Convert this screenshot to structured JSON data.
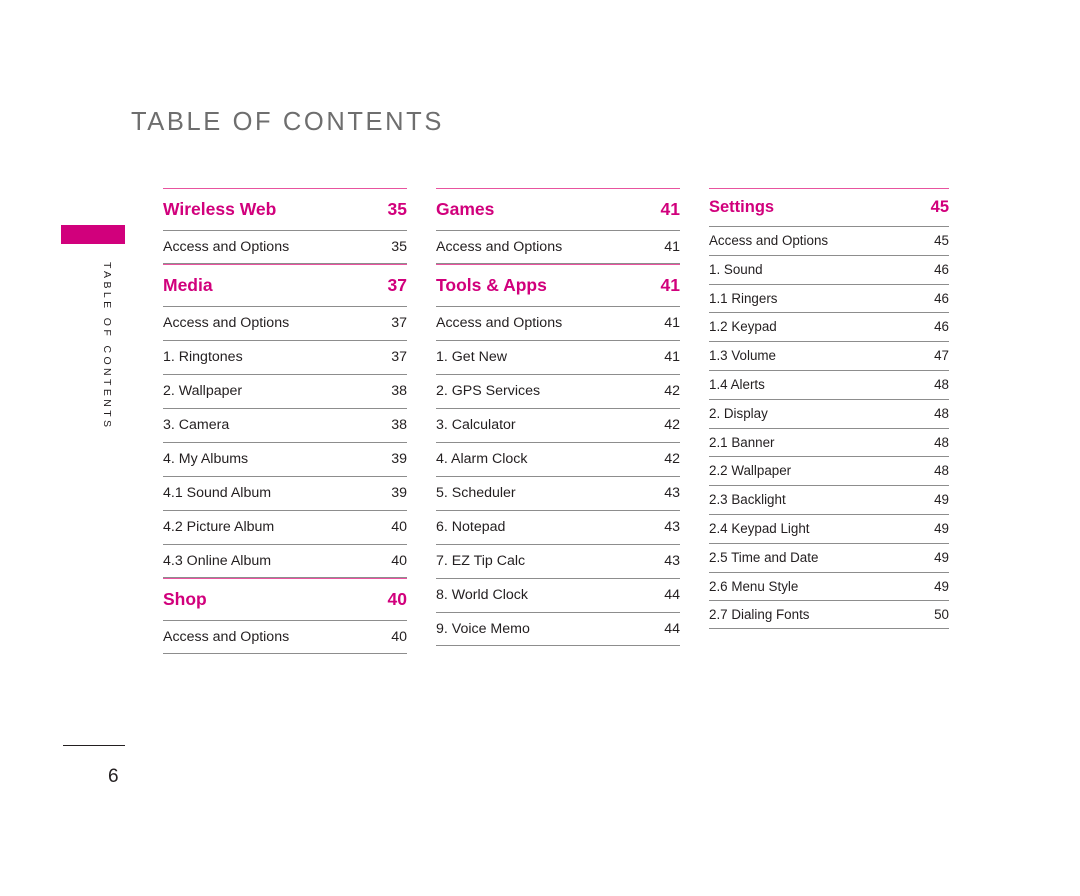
{
  "page": {
    "title": "TABLE OF CONTENTS",
    "side_tab_text": "TABLE OF CONTENTS",
    "page_number": "6",
    "accent_color": "#D1007C",
    "heading_rule_color": "#E8539F",
    "row_rule_color": "#8D8D8D",
    "title_color": "#6E6E6E",
    "body_text_color": "#231F20"
  },
  "columns": [
    {
      "sections": [
        {
          "title": "Wireless Web",
          "page": "35",
          "closed": true,
          "rows": [
            {
              "label": "Access and Options",
              "page": "35"
            }
          ]
        },
        {
          "title": "Media",
          "page": "37",
          "closed": true,
          "rows": [
            {
              "label": "Access and Options",
              "page": "37"
            },
            {
              "label": "1. Ringtones",
              "page": "37"
            },
            {
              "label": "2. Wallpaper",
              "page": "38"
            },
            {
              "label": "3. Camera",
              "page": "38"
            },
            {
              "label": "4. My Albums",
              "page": "39"
            },
            {
              "label": "4.1 Sound Album",
              "page": "39"
            },
            {
              "label": "4.2 Picture Album",
              "page": "40"
            },
            {
              "label": "4.3 Online Album",
              "page": "40"
            }
          ]
        },
        {
          "title": "Shop",
          "page": "40",
          "closed": true,
          "rows": [
            {
              "label": "Access and Options",
              "page": "40"
            }
          ]
        }
      ]
    },
    {
      "sections": [
        {
          "title": "Games",
          "page": "41",
          "closed": true,
          "rows": [
            {
              "label": "Access and Options",
              "page": "41"
            }
          ]
        },
        {
          "title": "Tools & Apps",
          "page": "41",
          "closed": true,
          "rows": [
            {
              "label": "Access and Options",
              "page": "41"
            },
            {
              "label": "1. Get New",
              "page": "41"
            },
            {
              "label": "2. GPS Services",
              "page": "42"
            },
            {
              "label": "3. Calculator",
              "page": "42"
            },
            {
              "label": "4. Alarm Clock",
              "page": "42"
            },
            {
              "label": "5. Scheduler",
              "page": "43"
            },
            {
              "label": "6. Notepad",
              "page": "43"
            },
            {
              "label": "7. EZ Tip Calc",
              "page": "43"
            },
            {
              "label": "8. World Clock",
              "page": "44"
            },
            {
              "label": "9. Voice Memo",
              "page": "44"
            }
          ]
        }
      ]
    },
    {
      "sections": [
        {
          "title": "Settings",
          "page": "45",
          "closed": true,
          "rows": [
            {
              "label": "Access and Options",
              "page": "45"
            },
            {
              "label": "1. Sound",
              "page": "46"
            },
            {
              "label": "1.1 Ringers",
              "page": "46"
            },
            {
              "label": "1.2 Keypad",
              "page": "46"
            },
            {
              "label": "1.3 Volume",
              "page": "47"
            },
            {
              "label": "1.4 Alerts",
              "page": "48"
            },
            {
              "label": "2. Display",
              "page": "48"
            },
            {
              "label": "2.1 Banner",
              "page": "48"
            },
            {
              "label": "2.2 Wallpaper",
              "page": "48"
            },
            {
              "label": "2.3 Backlight",
              "page": "49"
            },
            {
              "label": "2.4 Keypad Light",
              "page": "49"
            },
            {
              "label": "2.5 Time and Date",
              "page": "49"
            },
            {
              "label": "2.6 Menu Style",
              "page": "49"
            },
            {
              "label": "2.7 Dialing Fonts",
              "page": "50"
            }
          ]
        }
      ]
    }
  ]
}
